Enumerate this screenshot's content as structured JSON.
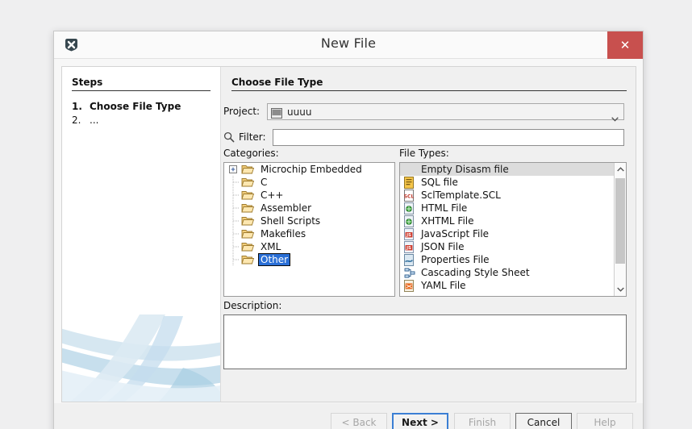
{
  "window": {
    "title": "New File",
    "icon": "app-x-icon",
    "close_label": "✕",
    "accent_close": "#c8504e"
  },
  "steps": {
    "heading": "Steps",
    "items": [
      {
        "num": "1.",
        "label": "Choose File Type",
        "current": true
      },
      {
        "num": "2.",
        "label": "...",
        "current": false
      }
    ]
  },
  "main": {
    "heading": "Choose File Type",
    "project": {
      "label": "Project:",
      "value": "uuuu",
      "icon": "project-icon",
      "dropdown_icon": "chevron-down-icon"
    },
    "filter": {
      "label": "Filter:",
      "value": "",
      "placeholder": "",
      "icon": "search-icon"
    },
    "categories": {
      "label": "Categories:",
      "items": [
        {
          "label": "Microchip Embedded",
          "expandable": true,
          "selected": false
        },
        {
          "label": "C",
          "expandable": false,
          "selected": false
        },
        {
          "label": "C++",
          "expandable": false,
          "selected": false
        },
        {
          "label": "Assembler",
          "expandable": false,
          "selected": false
        },
        {
          "label": "Shell Scripts",
          "expandable": false,
          "selected": false
        },
        {
          "label": "Makefiles",
          "expandable": false,
          "selected": false
        },
        {
          "label": "XML",
          "expandable": false,
          "selected": false
        },
        {
          "label": "Other",
          "expandable": false,
          "selected": true
        }
      ]
    },
    "file_types": {
      "label": "File Types:",
      "items": [
        {
          "label": "Empty Disasm file",
          "icon": "none",
          "selected": true
        },
        {
          "label": "SQL file",
          "icon": "sql-file-icon",
          "selected": false
        },
        {
          "label": "SclTemplate.SCL",
          "icon": "scl-file-icon",
          "selected": false
        },
        {
          "label": "HTML File",
          "icon": "html-file-icon",
          "selected": false
        },
        {
          "label": "XHTML File",
          "icon": "xhtml-file-icon",
          "selected": false
        },
        {
          "label": "JavaScript File",
          "icon": "js-file-icon",
          "selected": false
        },
        {
          "label": "JSON File",
          "icon": "json-file-icon",
          "selected": false
        },
        {
          "label": "Properties File",
          "icon": "properties-file-icon",
          "selected": false
        },
        {
          "label": "Cascading Style Sheet",
          "icon": "css-file-icon",
          "selected": false
        },
        {
          "label": "YAML File",
          "icon": "yaml-file-icon",
          "selected": false
        }
      ],
      "scrollbar": {
        "up_icon": "chevron-up-icon",
        "down_icon": "chevron-down-icon"
      }
    },
    "description": {
      "label": "Description:",
      "value": ""
    }
  },
  "footer": {
    "buttons": [
      {
        "label": "< Back",
        "state": "disabled"
      },
      {
        "label": "Next >",
        "state": "default"
      },
      {
        "label": "Finish",
        "state": "disabled"
      },
      {
        "label": "Cancel",
        "state": "normal"
      },
      {
        "label": "Help",
        "state": "disabled"
      }
    ]
  }
}
